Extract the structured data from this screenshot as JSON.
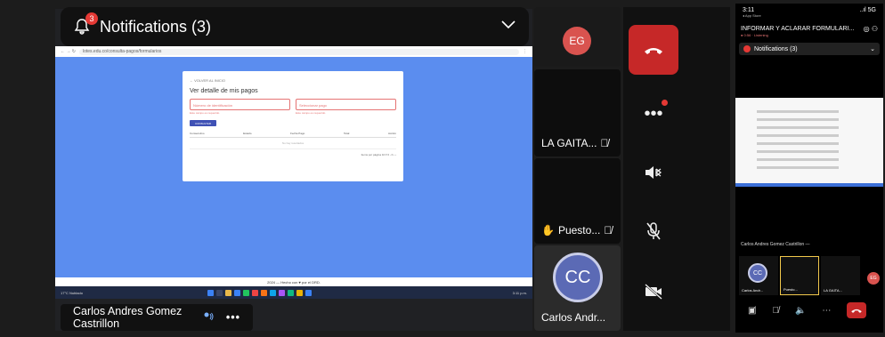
{
  "notification_banner": {
    "title": "Notifications (3)",
    "badge": "3"
  },
  "browser": {
    "url": "lotes.edu.co/consulta-pagos/formularios",
    "back_link": "← VOLVER AL INICIO",
    "heading": "Ver detalle de mis pagos",
    "field_1_placeholder": "Número de identificación",
    "field_2_placeholder": "Seleccionar pago",
    "field_1_error": "Este campo es requerido",
    "field_2_error": "Este campo es requerido",
    "button": "CONSULTAR",
    "table_headers": [
      "Consecutivo",
      "Estado",
      "Fecha Pago",
      "Total",
      "Acción"
    ],
    "empty_text": "No hay resultados",
    "pager": "Items por página  10  ▾   0 - 0   ‹  ›",
    "footer": "2024 — Hecho con ♥ por el DRD."
  },
  "taskbar": {
    "weather": "17°C Nublado",
    "search": "Buscar",
    "clock": "3:11 p.m.",
    "colors": [
      "#e8b84a",
      "#3b82f6",
      "#22c55e",
      "#ef4444",
      "#f97316",
      "#0ea5e9",
      "#a855f7",
      "#10b981",
      "#eab308",
      "#3b82f6",
      "#ef4444",
      "#6366f1"
    ]
  },
  "presenter": {
    "name": "Carlos Andres Gomez Castrillon",
    "dots": "•••"
  },
  "participants": {
    "eg_initials": "EG",
    "gaita_label": "LA GAITA...",
    "puesto_label": "Puesto...",
    "cc_initials": "CC",
    "cc_label": "Carlos Andr..."
  },
  "controls": {
    "hangup_icon": "phone-hangup-icon",
    "more": "•••"
  },
  "phone": {
    "time": "3:11",
    "time_sub": "◂ App Store",
    "signal": "..ıl 5G",
    "meeting_title": "INFORMAR Y ACLARAR FORMULARI...",
    "meeting_sub": "● 0:56 · Listening",
    "notif": "Notifications (3)",
    "caption": "Carlos Andres Gomez Castrillon",
    "tile_cc_initials": "CC",
    "tile_1": "Carlos Andr...",
    "tile_2": "Puesto...",
    "tile_3": "LA GAITA...",
    "eg_initials": "EG"
  }
}
